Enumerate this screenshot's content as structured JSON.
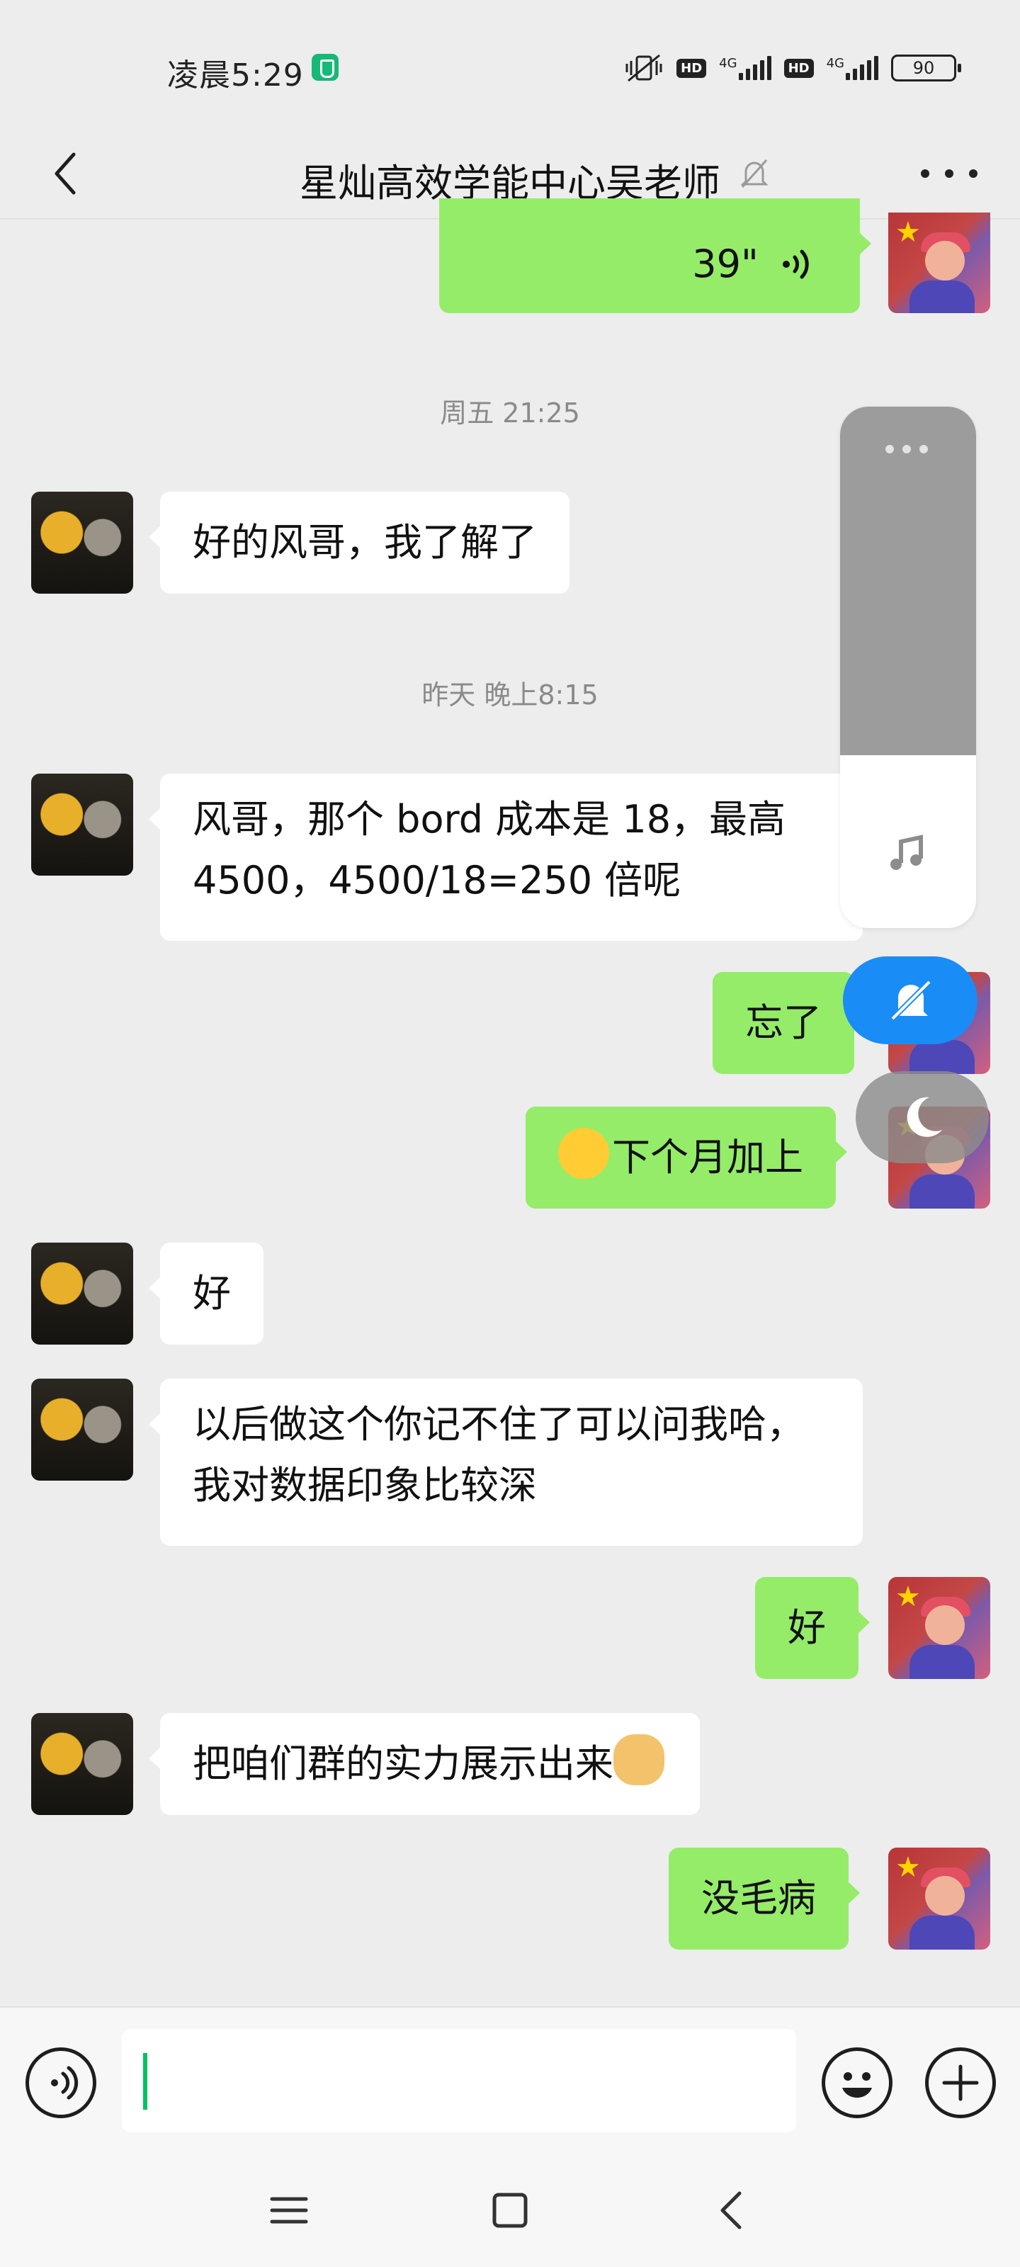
{
  "status_bar": {
    "time": "凌晨5:29",
    "network_1": "4G",
    "network_2": "4G",
    "battery": "90"
  },
  "header": {
    "title": "星灿高效学能中心吴老师"
  },
  "messages": [
    {
      "side": "right",
      "type": "voice",
      "duration": "39\""
    },
    {
      "type": "timestamp",
      "text": "周五 21:25"
    },
    {
      "side": "left",
      "text": "好的风哥，我了解了"
    },
    {
      "type": "timestamp",
      "text": "昨天 晚上8:15"
    },
    {
      "side": "left",
      "text": "风哥，那个 bord 成本是 18，最高 4500，4500/18=250 倍呢"
    },
    {
      "side": "right",
      "text": "忘了"
    },
    {
      "side": "right",
      "text": "下个月加上",
      "emoji": "laughing-tears"
    },
    {
      "side": "left",
      "text": "好"
    },
    {
      "side": "left",
      "text": "以后做这个你记不住了可以问我哈，我对数据印象比较深"
    },
    {
      "side": "right",
      "text": "好"
    },
    {
      "side": "left",
      "text": "把咱们群的实力展示出来",
      "emoji": "doge"
    },
    {
      "side": "right",
      "text": "没毛病"
    }
  ],
  "colors": {
    "outgoing_bubble": "#95ec69",
    "incoming_bubble": "#ffffff",
    "background": "#ededed",
    "cursor": "#07c160",
    "dnd_button": "#1a8cf5"
  },
  "input": {
    "value": ""
  }
}
